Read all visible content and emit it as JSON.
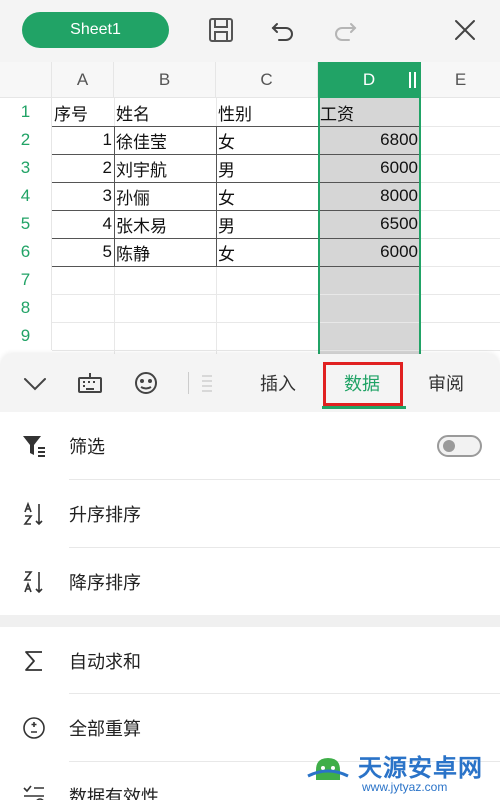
{
  "toolbar": {
    "sheet_name": "Sheet1",
    "icons": [
      "save-icon",
      "undo-icon",
      "redo-icon",
      "close-icon"
    ]
  },
  "grid": {
    "columns": [
      "A",
      "B",
      "C",
      "D",
      "E"
    ],
    "selected_column": "D",
    "rows": [
      "1",
      "2",
      "3",
      "4",
      "5",
      "6",
      "7",
      "8",
      "9"
    ],
    "header_row": [
      "序号",
      "姓名",
      "性别",
      "工资"
    ],
    "data": [
      {
        "no": "1",
        "name": "徐佳莹",
        "gender": "女",
        "salary": "6800"
      },
      {
        "no": "2",
        "name": "刘宇航",
        "gender": "男",
        "salary": "6000"
      },
      {
        "no": "3",
        "name": "孙俪",
        "gender": "女",
        "salary": "8000"
      },
      {
        "no": "4",
        "name": "张木易",
        "gender": "男",
        "salary": "6500"
      },
      {
        "no": "5",
        "name": "陈静",
        "gender": "女",
        "salary": "6000"
      }
    ]
  },
  "panel": {
    "tabs": [
      {
        "label": "插入",
        "active": false
      },
      {
        "label": "数据",
        "active": true
      },
      {
        "label": "审阅",
        "active": false
      }
    ],
    "tab_icons": [
      "collapse-chevron-icon",
      "keyboard-icon",
      "emoji-icon"
    ],
    "menu": [
      {
        "label": "筛选",
        "icon": "filter-icon",
        "toggle": false
      },
      {
        "label": "升序排序",
        "icon": "sort-ascending-icon"
      },
      {
        "label": "降序排序",
        "icon": "sort-descending-icon"
      },
      {
        "label": "自动求和",
        "icon": "sigma-icon"
      },
      {
        "label": "全部重算",
        "icon": "recalculate-icon"
      },
      {
        "label": "数据有效性",
        "icon": "data-validation-icon"
      }
    ]
  },
  "watermark": {
    "title": "天源安卓网",
    "url": "www.jytyaz.com"
  },
  "colors": {
    "accent": "#21a366",
    "highlight_box": "#e02020",
    "selection_fill": "#d6d6d6"
  }
}
